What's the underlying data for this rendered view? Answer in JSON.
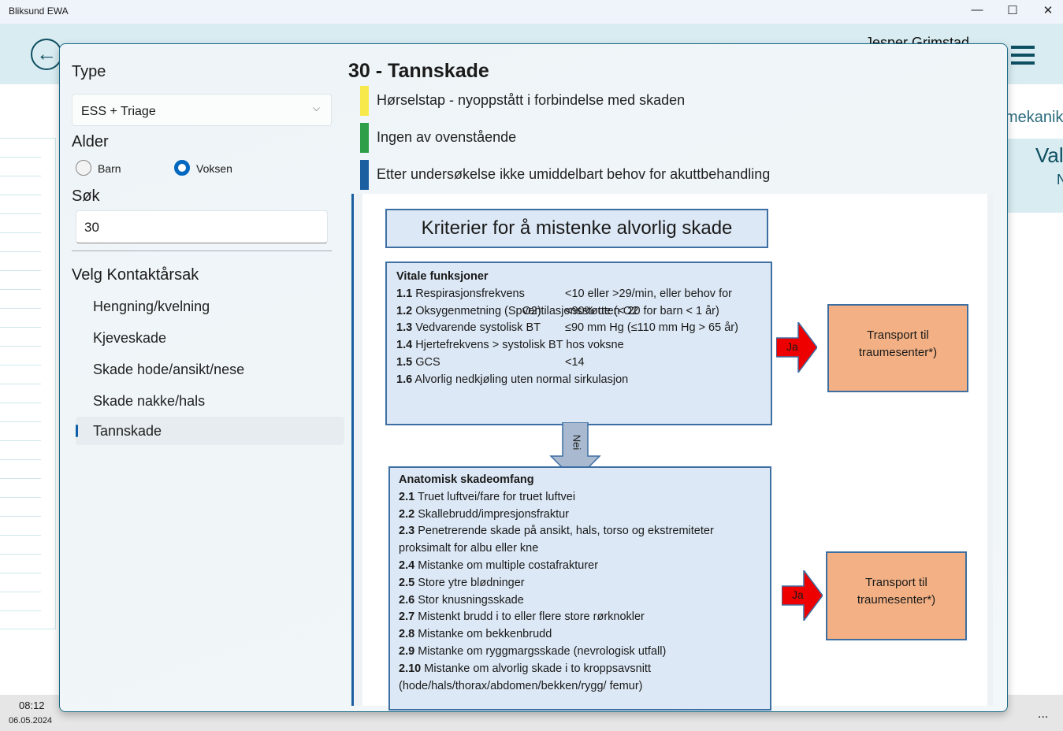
{
  "window": {
    "title": "Bliksund EWA",
    "min": "—",
    "max": "☐",
    "close": "✕"
  },
  "background": {
    "user": "Jesper Grimstad",
    "right_text": "mekanikk",
    "panel_title": "Val",
    "panel_sub": "N"
  },
  "taskbar": {
    "time": "08:12",
    "date": "06.05.2024",
    "more": "..."
  },
  "dialog": {
    "type_label": "Type",
    "type_value": "ESS + Triage",
    "age_label": "Alder",
    "age_options": [
      {
        "label": "Barn",
        "selected": false
      },
      {
        "label": "Voksen",
        "selected": true
      }
    ],
    "search_label": "Søk",
    "search_value": "30",
    "contact_label": "Velg Kontaktårsak",
    "items": [
      "Hengning/kvelning",
      "Kjeveskade",
      "Skade hode/ansikt/nese",
      "Skade nakke/hals",
      "Tannskade"
    ],
    "selected_item": "Tannskade",
    "heading": "30 - Tannskade",
    "criteria": [
      {
        "text": "Hørselstap - nyoppstått i forbindelse med skaden",
        "color": "#f7e94b"
      },
      {
        "text": "Ingen av ovenstående",
        "color": "#2e9e49"
      },
      {
        "text": "Etter undersøkelse ikke umiddelbart behov for akuttbehandling",
        "color": "#1b5fa0"
      }
    ],
    "figure": {
      "title": "Kriterier for å mistenke alvorlig skade",
      "vital_title": "Vitale funksjoner",
      "vital": [
        {
          "n": "1.1",
          "t": "Respirasjonsfrekvens",
          "v": "<10 eller >29/min, eller behov for"
        },
        {
          "n": "",
          "t": "",
          "v": "ventilasjonsstøtte (< 20 for barn < 1 år)"
        },
        {
          "n": "1.2",
          "t": "Oksygenmetning (SpO2)",
          "v": "<90% uten O2"
        },
        {
          "n": "1.3",
          "t": "Vedvarende systolisk BT",
          "v": "≤90 mm Hg (≤110 mm Hg > 65 år)"
        },
        {
          "n": "1.4",
          "t": "Hjertefrekvens > systolisk BT hos voksne",
          "v": ""
        },
        {
          "n": "1.5",
          "t": "GCS",
          "v": "<14"
        },
        {
          "n": "1.6",
          "t": "Alvorlig nedkjøling uten normal sirkulasjon",
          "v": ""
        }
      ],
      "no_label": "Nei",
      "yes_label": "Ja",
      "transport": "Transport til traumesenter*)",
      "anat_title": "Anatomisk skadeomfang",
      "anat": [
        {
          "n": "2.1",
          "t": "Truet luftvei/fare for truet luftvei"
        },
        {
          "n": "2.2",
          "t": "Skallebrudd/impresjonsfraktur"
        },
        {
          "n": "2.3",
          "t": "Penetrerende skade på ansikt, hals, torso og ekstremiteter"
        },
        {
          "n": "",
          "t": "proksimalt for albu eller kne"
        },
        {
          "n": "2.4",
          "t": "Mistanke om multiple costafrakturer"
        },
        {
          "n": "2.5",
          "t": "Store ytre blødninger"
        },
        {
          "n": "2.6",
          "t": "Stor knusningsskade"
        },
        {
          "n": "2.7",
          "t": "Mistenkt brudd i to eller flere store rørknokler"
        },
        {
          "n": "2.8",
          "t": "Mistanke om bekkenbrudd"
        },
        {
          "n": "2.9",
          "t": "Mistanke om ryggmargsskade (nevrologisk utfall)"
        },
        {
          "n": "2.10",
          "t": "Mistanke om alvorlig skade i to kroppsavsnitt"
        },
        {
          "n": "",
          "t": "(hode/hals/thorax/abdomen/bekken/rygg/ femur)"
        }
      ]
    }
  }
}
